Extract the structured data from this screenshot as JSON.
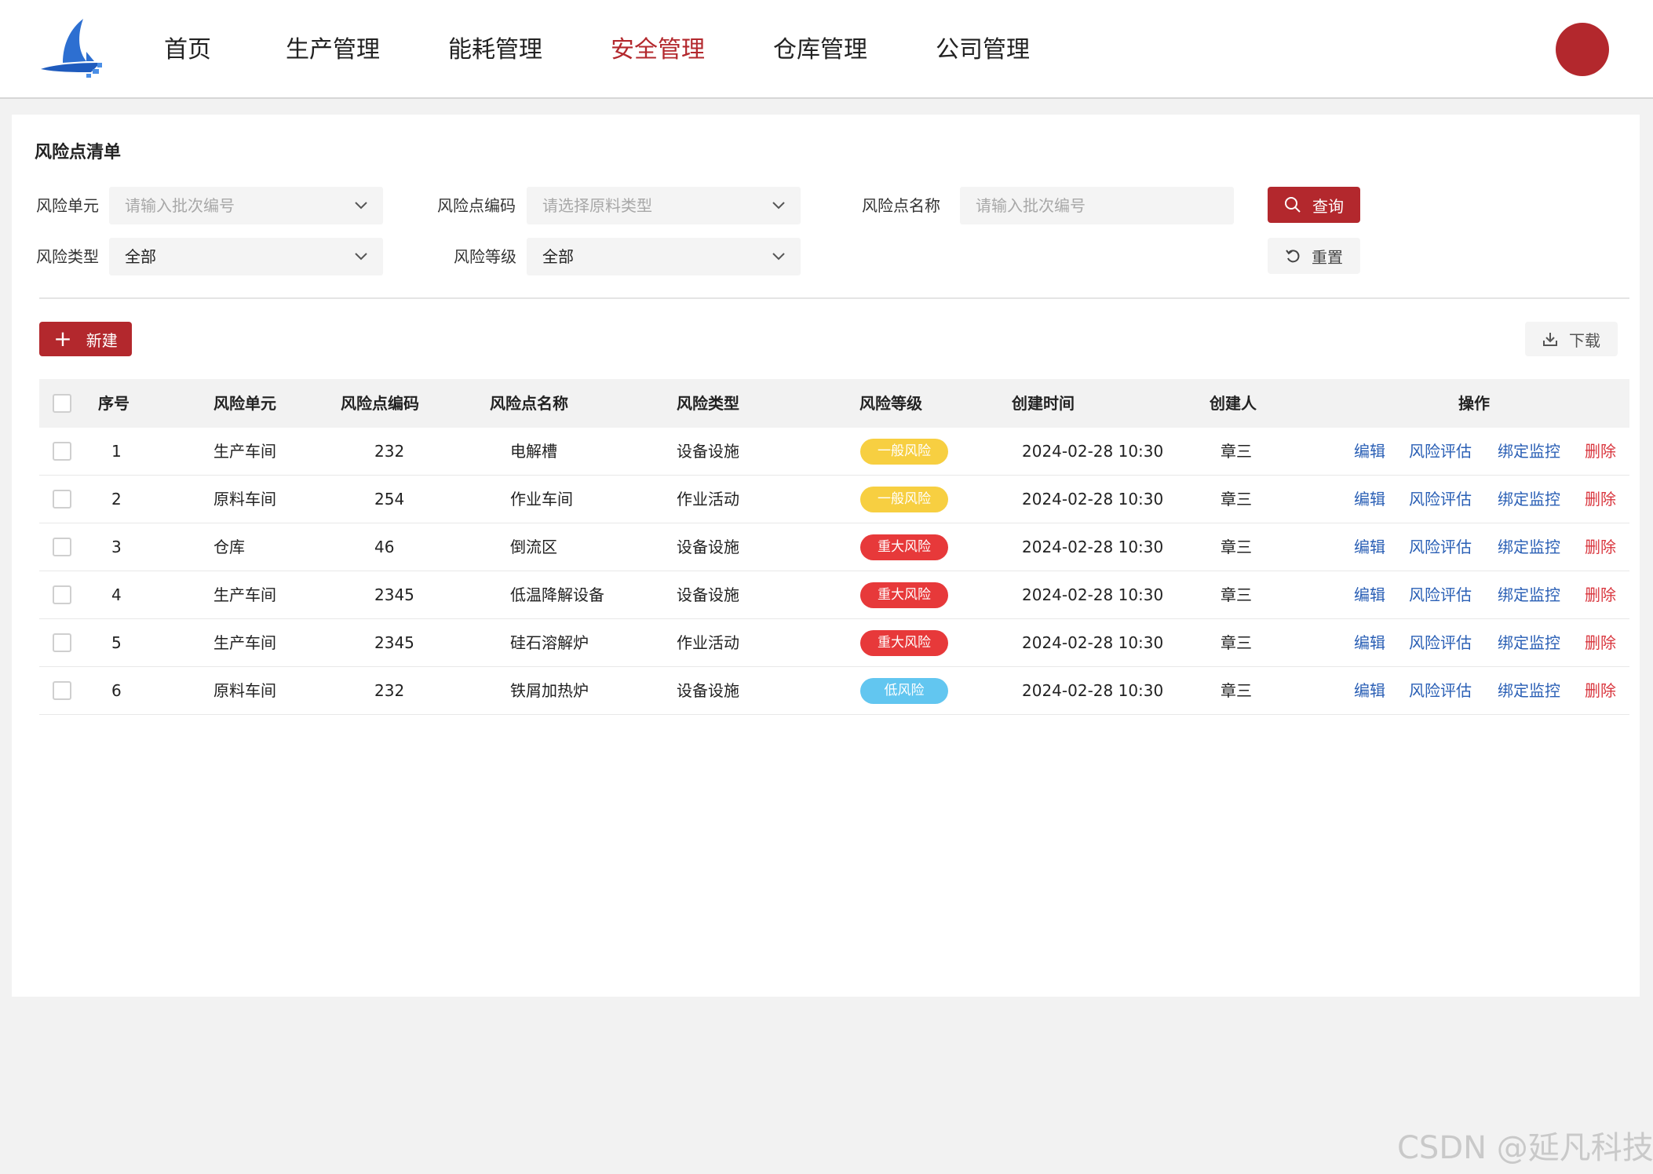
{
  "nav": {
    "items": [
      "首页",
      "生产管理",
      "能耗管理",
      "安全管理",
      "仓库管理",
      "公司管理"
    ],
    "active": "安全管理"
  },
  "panel": {
    "title": "风险点清单"
  },
  "filters": {
    "risk_unit": {
      "label": "风险单元",
      "placeholder": "请输入批次编号"
    },
    "risk_code": {
      "label": "风险点编码",
      "placeholder": "请选择原料类型"
    },
    "risk_name": {
      "label": "风险点名称",
      "placeholder": "请输入批次编号"
    },
    "risk_type": {
      "label": "风险类型",
      "value": "全部"
    },
    "risk_level": {
      "label": "风险等级",
      "value": "全部"
    }
  },
  "buttons": {
    "query": "查询",
    "reset": "重置",
    "new": "新建",
    "download": "下载"
  },
  "table": {
    "headers": [
      "序号",
      "风险单元",
      "风险点编码",
      "风险点名称",
      "风险类型",
      "风险等级",
      "创建时间",
      "创建人",
      "操作"
    ],
    "rows": [
      {
        "no": "1",
        "unit": "生产车间",
        "code": "232",
        "name": "电解槽",
        "type": "设备设施",
        "level": "一般风险",
        "level_color": "yellow",
        "time": "2024-02-28  10:30",
        "creator": "章三"
      },
      {
        "no": "2",
        "unit": "原料车间",
        "code": "254",
        "name": "作业车间",
        "type": "作业活动",
        "level": "一般风险",
        "level_color": "yellow",
        "time": "2024-02-28  10:30",
        "creator": "章三"
      },
      {
        "no": "3",
        "unit": "仓库",
        "code": "46",
        "name": "倒流区",
        "type": "设备设施",
        "level": "重大风险",
        "level_color": "red",
        "time": "2024-02-28  10:30",
        "creator": "章三"
      },
      {
        "no": "4",
        "unit": "生产车间",
        "code": "2345",
        "name": "低温降解设备",
        "type": "设备设施",
        "level": "重大风险",
        "level_color": "red",
        "time": "2024-02-28  10:30",
        "creator": "章三"
      },
      {
        "no": "5",
        "unit": "生产车间",
        "code": "2345",
        "name": "硅石溶解炉",
        "type": "作业活动",
        "level": "重大风险",
        "level_color": "red",
        "time": "2024-02-28  10:30",
        "creator": "章三"
      },
      {
        "no": "6",
        "unit": "原料车间",
        "code": "232",
        "name": "铁屑加热炉",
        "type": "设备设施",
        "level": "低风险",
        "level_color": "blue",
        "time": "2024-02-28  10:30",
        "creator": "章三"
      }
    ],
    "actions": {
      "edit": "编辑",
      "assess": "风险评估",
      "bind": "绑定监控",
      "delete": "删除"
    }
  },
  "colors": {
    "brand": "#b3282d",
    "link": "#2a5fb5",
    "danger": "#d9363e",
    "badge_yellow": "#f7cf41",
    "badge_red": "#e7393a",
    "badge_blue": "#62c6f0"
  },
  "watermark": "CSDN @延凡科技"
}
